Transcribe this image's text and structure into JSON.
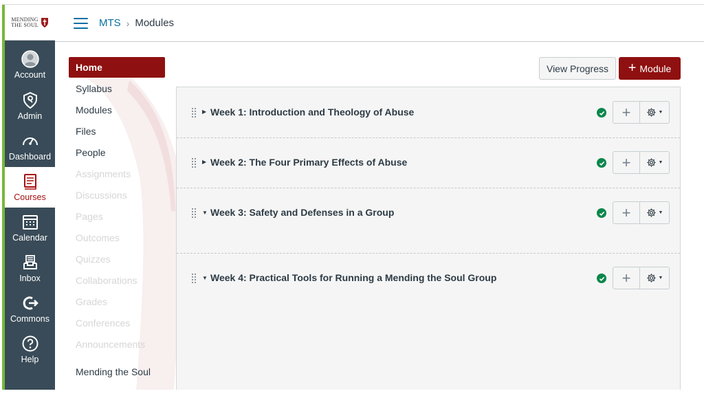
{
  "brand": {
    "logo_line1": "MENDING",
    "logo_line2": "THE SOUL"
  },
  "global_nav": [
    {
      "label": "Account",
      "icon": "avatar-icon"
    },
    {
      "label": "Admin",
      "icon": "shield-icon"
    },
    {
      "label": "Dashboard",
      "icon": "speedometer-icon"
    },
    {
      "label": "Courses",
      "icon": "book-icon",
      "active": true
    },
    {
      "label": "Calendar",
      "icon": "calendar-icon"
    },
    {
      "label": "Inbox",
      "icon": "inbox-icon"
    },
    {
      "label": "Commons",
      "icon": "commons-icon"
    },
    {
      "label": "Help",
      "icon": "question-icon"
    }
  ],
  "breadcrumb": {
    "course": "MTS",
    "separator": "›",
    "current": "Modules"
  },
  "course_nav": {
    "home": "Home",
    "items": [
      {
        "label": "Syllabus",
        "enabled": true
      },
      {
        "label": "Modules",
        "enabled": true
      },
      {
        "label": "Files",
        "enabled": true
      },
      {
        "label": "People",
        "enabled": true
      },
      {
        "label": "Assignments",
        "enabled": false
      },
      {
        "label": "Discussions",
        "enabled": false
      },
      {
        "label": "Pages",
        "enabled": false
      },
      {
        "label": "Outcomes",
        "enabled": false
      },
      {
        "label": "Quizzes",
        "enabled": false
      },
      {
        "label": "Collaborations",
        "enabled": false
      },
      {
        "label": "Grades",
        "enabled": false
      },
      {
        "label": "Conferences",
        "enabled": false
      },
      {
        "label": "Announcements",
        "enabled": false
      },
      {
        "label": "Mending the Soul",
        "enabled": true
      }
    ]
  },
  "actions": {
    "view_progress": "View Progress",
    "add_module": "Module",
    "add_module_icon": "plus-icon"
  },
  "modules": [
    {
      "title": "Week 1: Introduction and Theology of Abuse",
      "expanded": false,
      "published": true
    },
    {
      "title": "Week 2: The Four Primary Effects of Abuse",
      "expanded": false,
      "published": true
    },
    {
      "title": "Week 3: Safety and Defenses in a Group",
      "expanded": true,
      "published": true
    },
    {
      "title": "Week 4: Practical Tools for Running a Mending the Soul Group",
      "expanded": true,
      "published": true
    }
  ],
  "colors": {
    "brand_red": "#8f1010",
    "nav_bg": "#394b58",
    "nav_accent": "#77b83a",
    "link_blue": "#0770a3",
    "published_green": "#0b874b"
  }
}
